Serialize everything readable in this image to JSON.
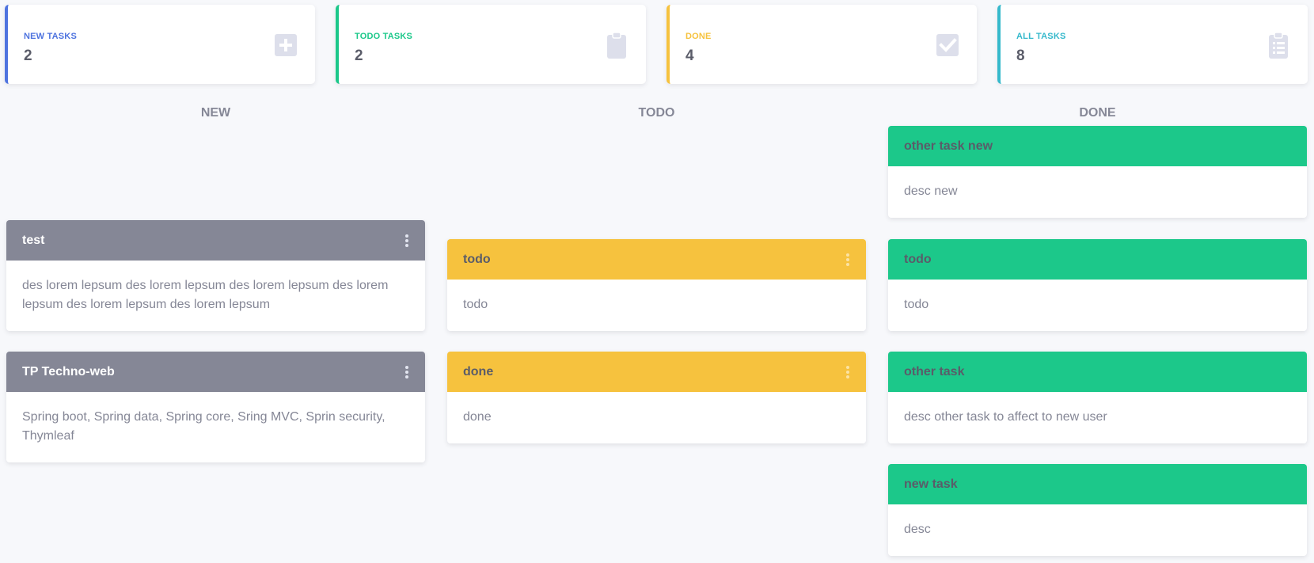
{
  "stats": [
    {
      "label": "NEW TASKS",
      "value": "2",
      "color": "#4e73df",
      "icon": "plus-square-icon"
    },
    {
      "label": "TODO TASKS",
      "value": "2",
      "color": "#1cc88a",
      "icon": "clipboard-icon"
    },
    {
      "label": "DONE",
      "value": "4",
      "color": "#f6c23e",
      "icon": "check-square-icon"
    },
    {
      "label": "ALL TASKS",
      "value": "8",
      "color": "#36b9cc",
      "icon": "clipboard-list-icon"
    }
  ],
  "columns": {
    "new": {
      "title": "NEW",
      "tasks": [
        {
          "title": "test",
          "desc": "des lorem lepsum des lorem lepsum des lorem lepsum des lorem lepsum des lorem lepsum des lorem lepsum"
        },
        {
          "title": "TP Techno-web",
          "desc": "Spring boot, Spring data, Spring core, Sring MVC, Sprin security, Thymleaf"
        }
      ]
    },
    "todo": {
      "title": "TODO",
      "tasks": [
        {
          "title": "todo",
          "desc": "todo"
        },
        {
          "title": "done",
          "desc": "done"
        }
      ]
    },
    "done": {
      "title": "DONE",
      "tasks": [
        {
          "title": "other task new",
          "desc": "desc new"
        },
        {
          "title": "todo",
          "desc": "todo"
        },
        {
          "title": "other task",
          "desc": "desc other task to affect to new user"
        },
        {
          "title": "new task",
          "desc": "desc"
        }
      ]
    }
  },
  "colors": {
    "new_header": "#858796",
    "todo_header": "#f6c23e",
    "done_header": "#1cc88a",
    "icon_gray": "#dddfeb"
  }
}
